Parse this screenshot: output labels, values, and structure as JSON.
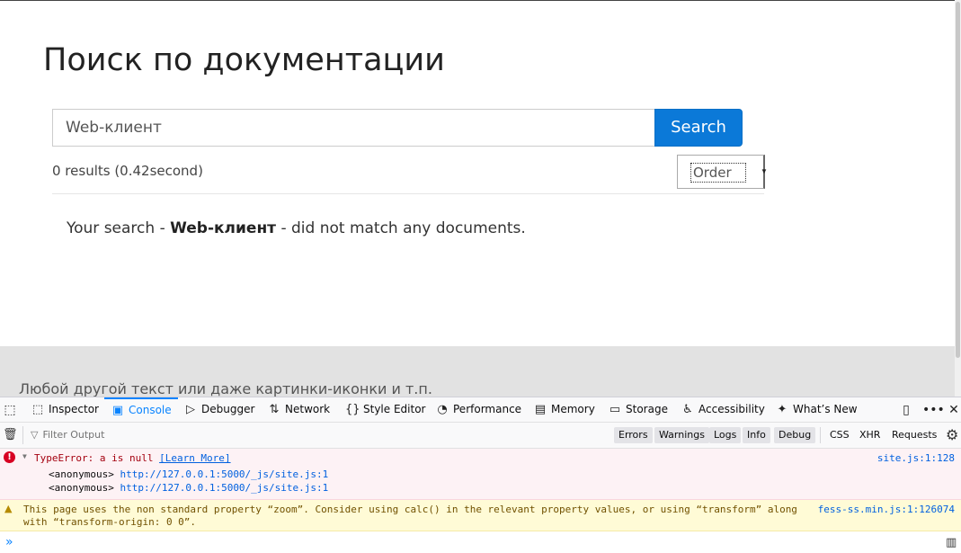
{
  "page": {
    "title": "Поиск по документации",
    "search": {
      "value": "Web-клиент",
      "button_label": "Search"
    },
    "result_count": "0 results (0.42second)",
    "order_label": "Order",
    "no_match": {
      "prefix": "Your search - ",
      "query": "Web-клиент",
      "suffix": " - did not match any documents."
    },
    "footer_text": "Любой другой текст или даже картинки-иконки и т.п."
  },
  "devtools": {
    "tabs": [
      {
        "label": "Inspector",
        "icon": "inspector-icon"
      },
      {
        "label": "Console",
        "icon": "console-icon"
      },
      {
        "label": "Debugger",
        "icon": "debugger-icon"
      },
      {
        "label": "Network",
        "icon": "network-icon"
      },
      {
        "label": "Style Editor",
        "icon": "style-editor-icon"
      },
      {
        "label": "Performance",
        "icon": "performance-icon"
      },
      {
        "label": "Memory",
        "icon": "memory-icon"
      },
      {
        "label": "Storage",
        "icon": "storage-icon"
      },
      {
        "label": "Accessibility",
        "icon": "accessibility-icon"
      },
      {
        "label": "What’s New",
        "icon": "whats-new-icon"
      }
    ],
    "active_tab": "Console",
    "filter_placeholder": "Filter Output",
    "filter_buttons": [
      "Errors",
      "Warnings",
      "Logs",
      "Info",
      "Debug"
    ],
    "extra_filters": [
      "CSS",
      "XHR",
      "Requests"
    ],
    "error": {
      "text": "TypeError: a is null",
      "learn_more": "[Learn More]",
      "location": "site.js:1:128",
      "stack": [
        {
          "fn": "<anonymous>",
          "link": "http://127.0.0.1:5000/_js/site.js:1"
        },
        {
          "fn": "<anonymous>",
          "link": "http://127.0.0.1:5000/_js/site.js:1"
        }
      ]
    },
    "warning": {
      "text": "This page uses the non standard property “zoom”. Consider using calc() in the relevant property values, or using “transform” along with “transform-origin: 0 0”.",
      "location": "fess-ss.min.js:1:126074"
    }
  }
}
